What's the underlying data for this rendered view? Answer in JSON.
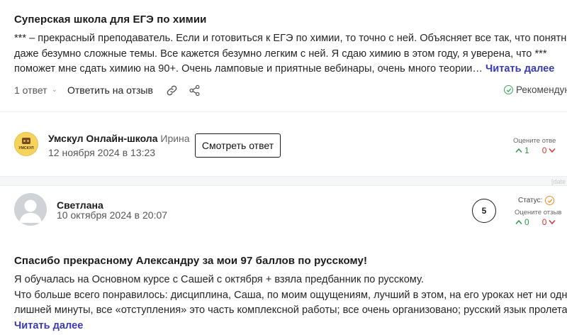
{
  "review1": {
    "title": "Суперская школа для ЕГЭ по химии",
    "lines": [
      "*** – прекрасный преподаватель. Если и готовиться к ЕГЭ по химии, то точно с ней. Объясняет все так, что понятны",
      "даже безумно сложные темы. Все кажется безумно легким с ней. Я сдаю химию в этом году, я уверена, что ***",
      "поможет мне сдать химию на 90+. Очень ламповые и приятные вебинары, очень много теории…"
    ],
    "read_more": "Читать далее",
    "answers": "1 ответ",
    "reply_label": "Ответить на отзыв",
    "recommend": "Рекомендую"
  },
  "school_reply": {
    "logo_text": "УМСКУЛ",
    "name": "Умскул Онлайн-школа",
    "person": "Ирина",
    "date": "12 ноября 2024 в 13:23",
    "button": "Смотреть ответ",
    "rate_label": "Оцените отве",
    "up_count": "1",
    "down_count": "0"
  },
  "band_tag": "[date",
  "review2": {
    "name": "Светлана",
    "date": "10 октября 2024 в 20:07",
    "rating": "5",
    "status_label": "Статус:",
    "rate_label": "Оцените отзыв",
    "up_count": "0",
    "down_count": "0",
    "title": "Спасибо прекрасному Александру за мои 97 баллов по русскому!",
    "lines": [
      "Я обучалась на Основном курсе с Сашей с октября + взяла предбанник по русскому.",
      "Что больше всего понравилось: дисциплина, Саша, по моим ощущениям, лучший в этом, на его уроках нет ни одной",
      "лишней минуты, все «отступления» это часть комплексной работы; все очень организовано; русский язык пролетает…"
    ],
    "read_more": "Читать далее"
  },
  "colors": {
    "accent_link": "#3b3bb8",
    "positive": "#2f9a4c",
    "negative": "#d93636",
    "status": "#f08a24"
  }
}
